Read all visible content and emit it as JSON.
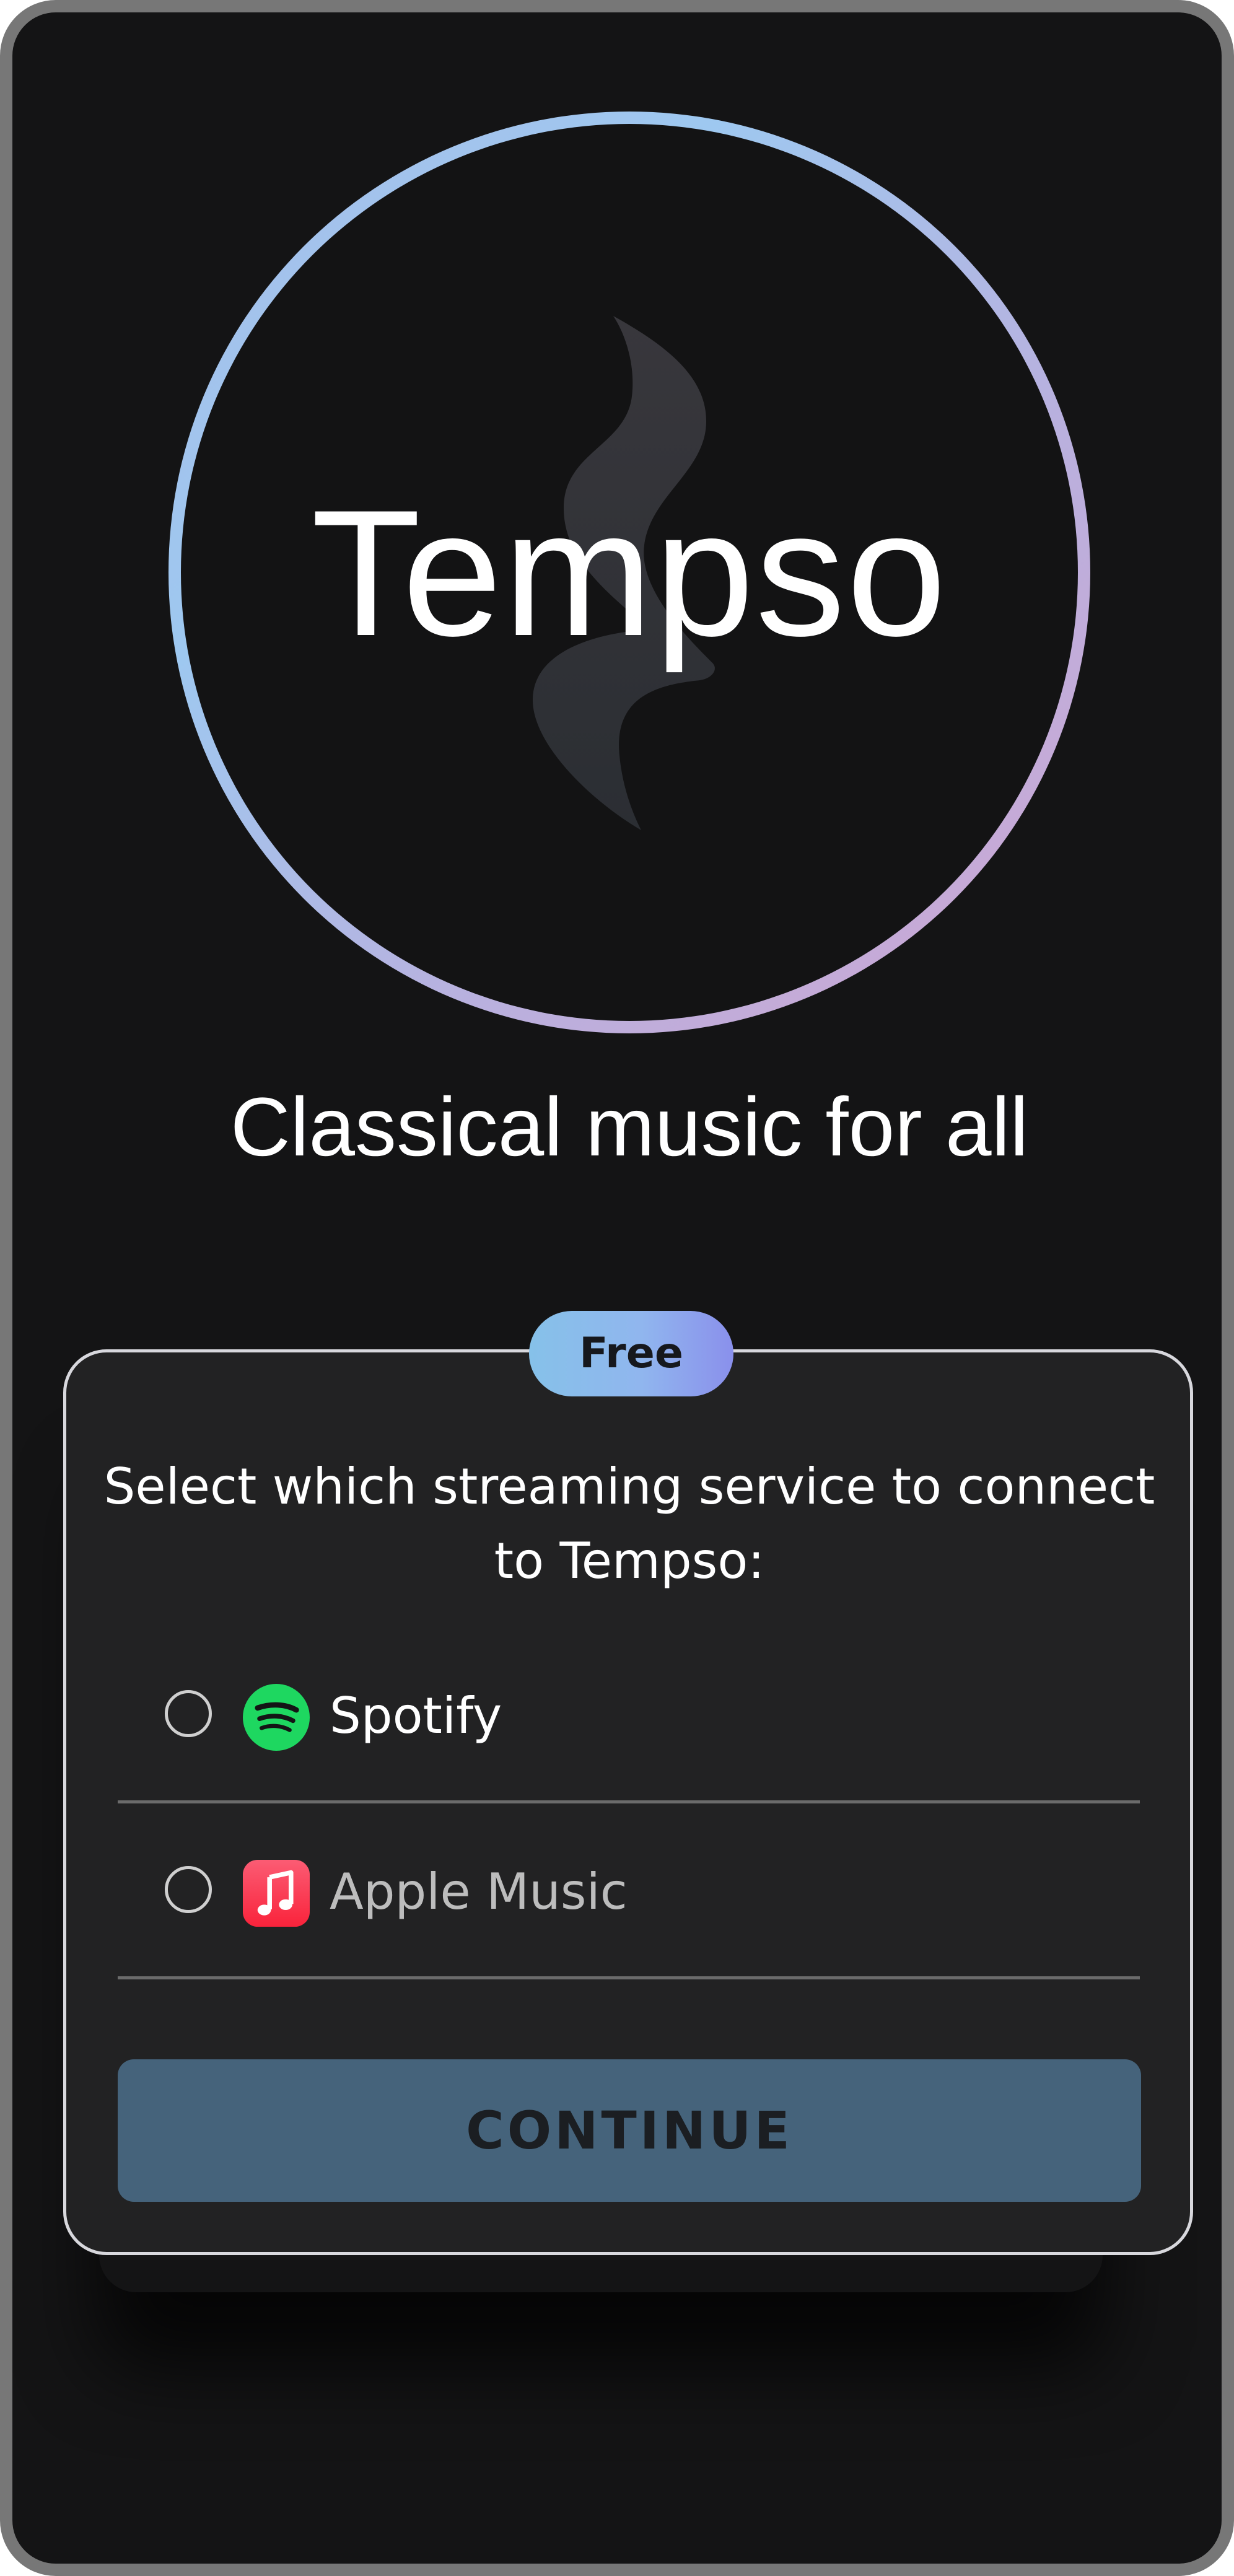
{
  "app": {
    "name": "Tempso",
    "tagline": "Classical music for all"
  },
  "badge": {
    "label": "Free"
  },
  "card": {
    "prompt": "Select which streaming service to connect to Tempso:",
    "options": [
      {
        "label": "Spotify",
        "icon": "spotify-icon",
        "label_color": "#ffffff",
        "selected": false
      },
      {
        "label": "Apple Music",
        "icon": "apple-music-icon",
        "label_color": "#bdbdbd",
        "selected": false
      }
    ],
    "continue_label": "CONTINUE"
  },
  "colors": {
    "background": "#141415",
    "card": "#222223",
    "continue_button": "#45637b",
    "spotify_green": "#1ed760",
    "apple_music_red": "#fa4659",
    "ring_gradient": [
      "#9ec8f0",
      "#cfa6d2"
    ]
  }
}
